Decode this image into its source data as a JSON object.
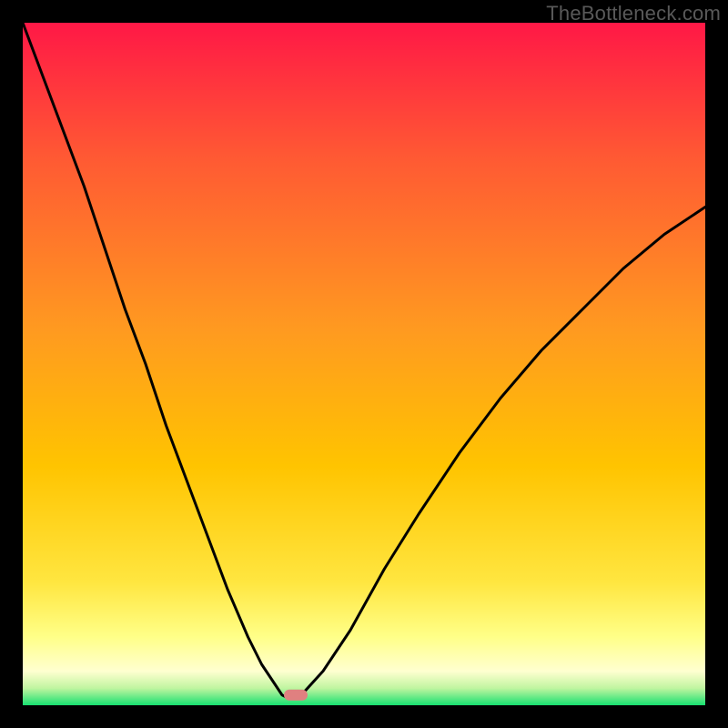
{
  "watermark": "TheBottleneck.com",
  "chart_data": {
    "type": "line",
    "title": "",
    "xlabel": "",
    "ylabel": "",
    "xlim": [
      0,
      100
    ],
    "ylim": [
      0,
      100
    ],
    "grid": false,
    "legend": false,
    "background_gradient_colors": {
      "top": "#ff1846",
      "mid": "#ffc400",
      "near_bottom_band_top": "#ffff88",
      "near_bottom_band_bottom": "#ffffd0",
      "bottom": "#18e070"
    },
    "marker": {
      "approx_x": 40,
      "approx_y": 1.5,
      "color": "#e08080"
    },
    "series": [
      {
        "name": "curve",
        "x": [
          0,
          3,
          6,
          9,
          12,
          15,
          18,
          21,
          24,
          27,
          30,
          33,
          35,
          37,
          38,
          39,
          40,
          41,
          44,
          48,
          53,
          58,
          64,
          70,
          76,
          82,
          88,
          94,
          100
        ],
        "y": [
          100,
          92,
          84,
          76,
          67,
          58,
          50,
          41,
          33,
          25,
          17,
          10,
          6,
          3,
          1.5,
          1,
          1.2,
          1.7,
          5,
          11,
          20,
          28,
          37,
          45,
          52,
          58,
          64,
          69,
          73
        ]
      }
    ]
  }
}
